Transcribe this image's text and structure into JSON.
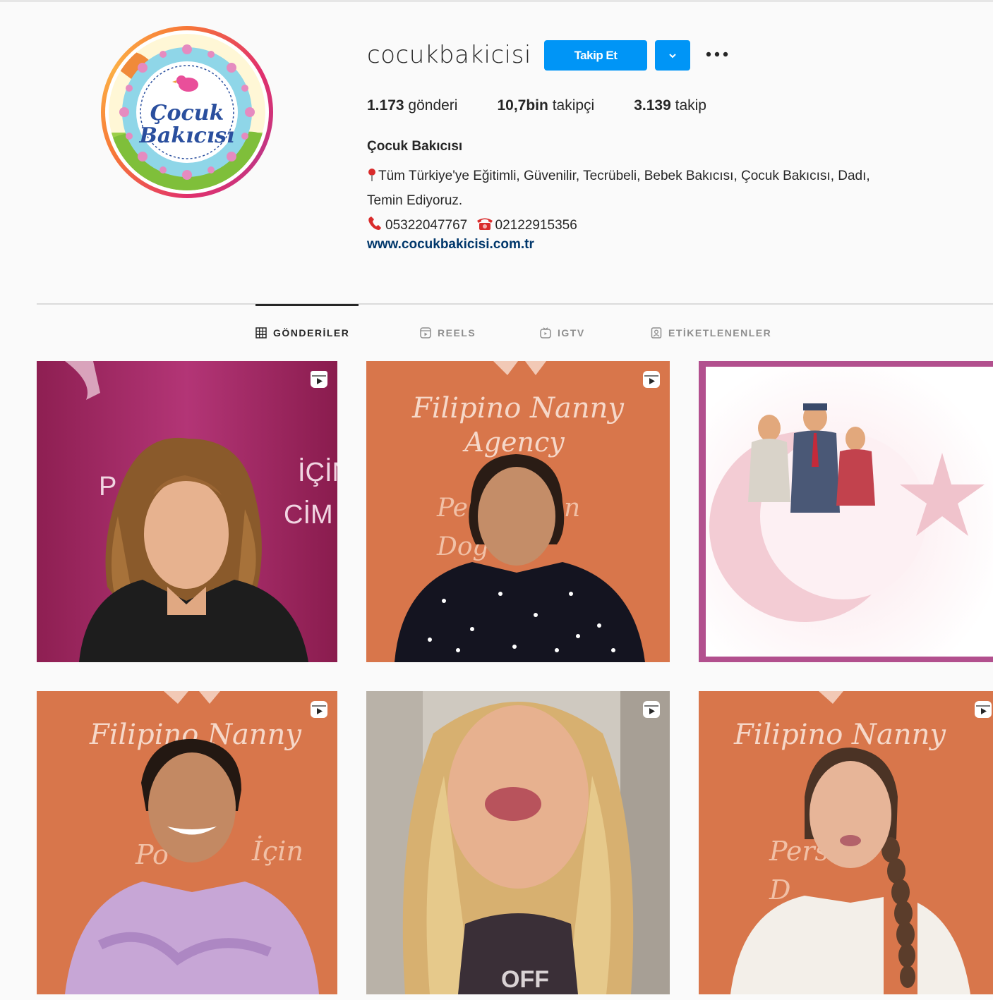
{
  "profile": {
    "username": "cocukbakicisi",
    "follow_label": "Takip Et",
    "full_name": "Çocuk Bakıcısı",
    "logo_text": [
      "Çocuk",
      "Bakıcısı"
    ],
    "stats": {
      "posts_value": "1.173",
      "posts_label": "gönderi",
      "followers_value": "10,7bin",
      "followers_label": "takipçi",
      "following_value": "3.139",
      "following_label": "takip"
    },
    "bio_line1": "Tüm Türkiye'ye Eğitimli, Güvenilir, Tecrübeli, Bebek Bakıcısı, Çocuk Bakıcısı, Dadı,",
    "bio_line2": "Temin Ediyoruz.",
    "phone_mobile": "05322047767",
    "phone_landline": "02122915356",
    "website": "www.cocukbakicisi.com.tr"
  },
  "tabs": [
    {
      "label": "GÖNDERİLER",
      "icon": "grid-icon",
      "active": true
    },
    {
      "label": "REELS",
      "icon": "reels-icon",
      "active": false
    },
    {
      "label": "IGTV",
      "icon": "igtv-icon",
      "active": false
    },
    {
      "label": "ETİKETLENENLER",
      "icon": "tagged-icon",
      "active": false
    }
  ],
  "posts": [
    {
      "banner_text": "İÇİN",
      "banner_text2": "CİM",
      "type": "reel"
    },
    {
      "banner_text": "Filipino Nanny",
      "banner_text2": "Agency",
      "type": "reel"
    },
    {
      "type": "image"
    },
    {
      "banner_text": "Filipino Nanny",
      "banner_text2": "İçin",
      "type": "reel"
    },
    {
      "banner_text": "OFF",
      "type": "reel"
    },
    {
      "banner_text": "Filipino Nanny",
      "type": "reel"
    }
  ],
  "colors": {
    "accent": "#0095f6",
    "link": "#00376b",
    "magenta_bg": "#a0245e",
    "orange_bg": "#d9774d"
  }
}
